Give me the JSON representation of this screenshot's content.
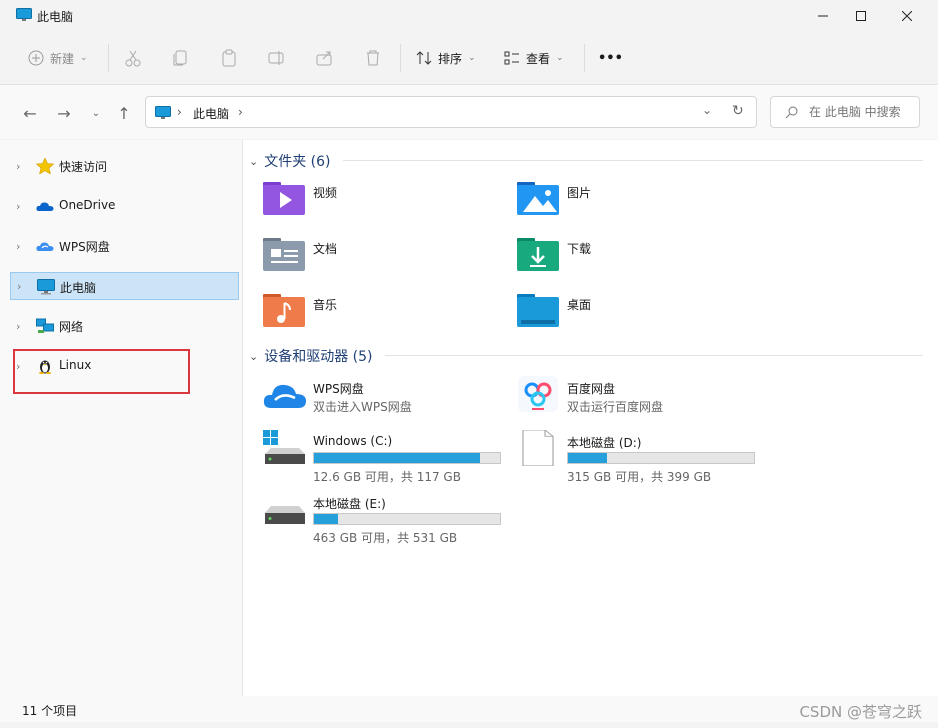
{
  "window": {
    "title": "此电脑"
  },
  "toolbar": {
    "new_label": "新建",
    "sort_label": "排序",
    "view_label": "查看",
    "more_label": "•••"
  },
  "address": {
    "crumb": "此电脑"
  },
  "search": {
    "placeholder": "在 此电脑 中搜索"
  },
  "sidebar": {
    "items": [
      {
        "label": "快速访问",
        "icon": "star-icon"
      },
      {
        "label": "OneDrive",
        "icon": "cloud-icon"
      },
      {
        "label": "WPS网盘",
        "icon": "wps-cloud-icon"
      },
      {
        "label": "此电脑",
        "icon": "computer-icon",
        "selected": true
      },
      {
        "label": "网络",
        "icon": "network-icon"
      },
      {
        "label": "Linux",
        "icon": "linux-penguin-icon"
      }
    ]
  },
  "folders": {
    "header": "文件夹 (6)",
    "items": [
      {
        "label": "视频",
        "icon": "videos-folder-icon"
      },
      {
        "label": "图片",
        "icon": "pictures-folder-icon"
      },
      {
        "label": "文档",
        "icon": "documents-folder-icon"
      },
      {
        "label": "下载",
        "icon": "downloads-folder-icon"
      },
      {
        "label": "音乐",
        "icon": "music-folder-icon"
      },
      {
        "label": "桌面",
        "icon": "desktop-folder-icon"
      }
    ]
  },
  "devices": {
    "header": "设备和驱动器 (5)",
    "wps": {
      "label": "WPS网盘",
      "sub": "双击进入WPS网盘"
    },
    "baidu": {
      "label": "百度网盘",
      "sub": "双击运行百度网盘"
    },
    "drives": [
      {
        "label": "Windows (C:)",
        "size": "12.6 GB 可用，共 117 GB",
        "used_fraction": 0.892
      },
      {
        "label": "本地磁盘 (D:)",
        "size": "315 GB 可用，共 399 GB",
        "used_fraction": 0.211
      },
      {
        "label": "本地磁盘 (E:)",
        "size": "463 GB 可用，共 531 GB",
        "used_fraction": 0.128
      }
    ]
  },
  "status": {
    "count": "11 个项目"
  },
  "watermark": "CSDN @苍穹之跃",
  "colors": {
    "accent": "#26a0da",
    "selection": "#cce4f7",
    "highlight_box": "#d9363e"
  }
}
